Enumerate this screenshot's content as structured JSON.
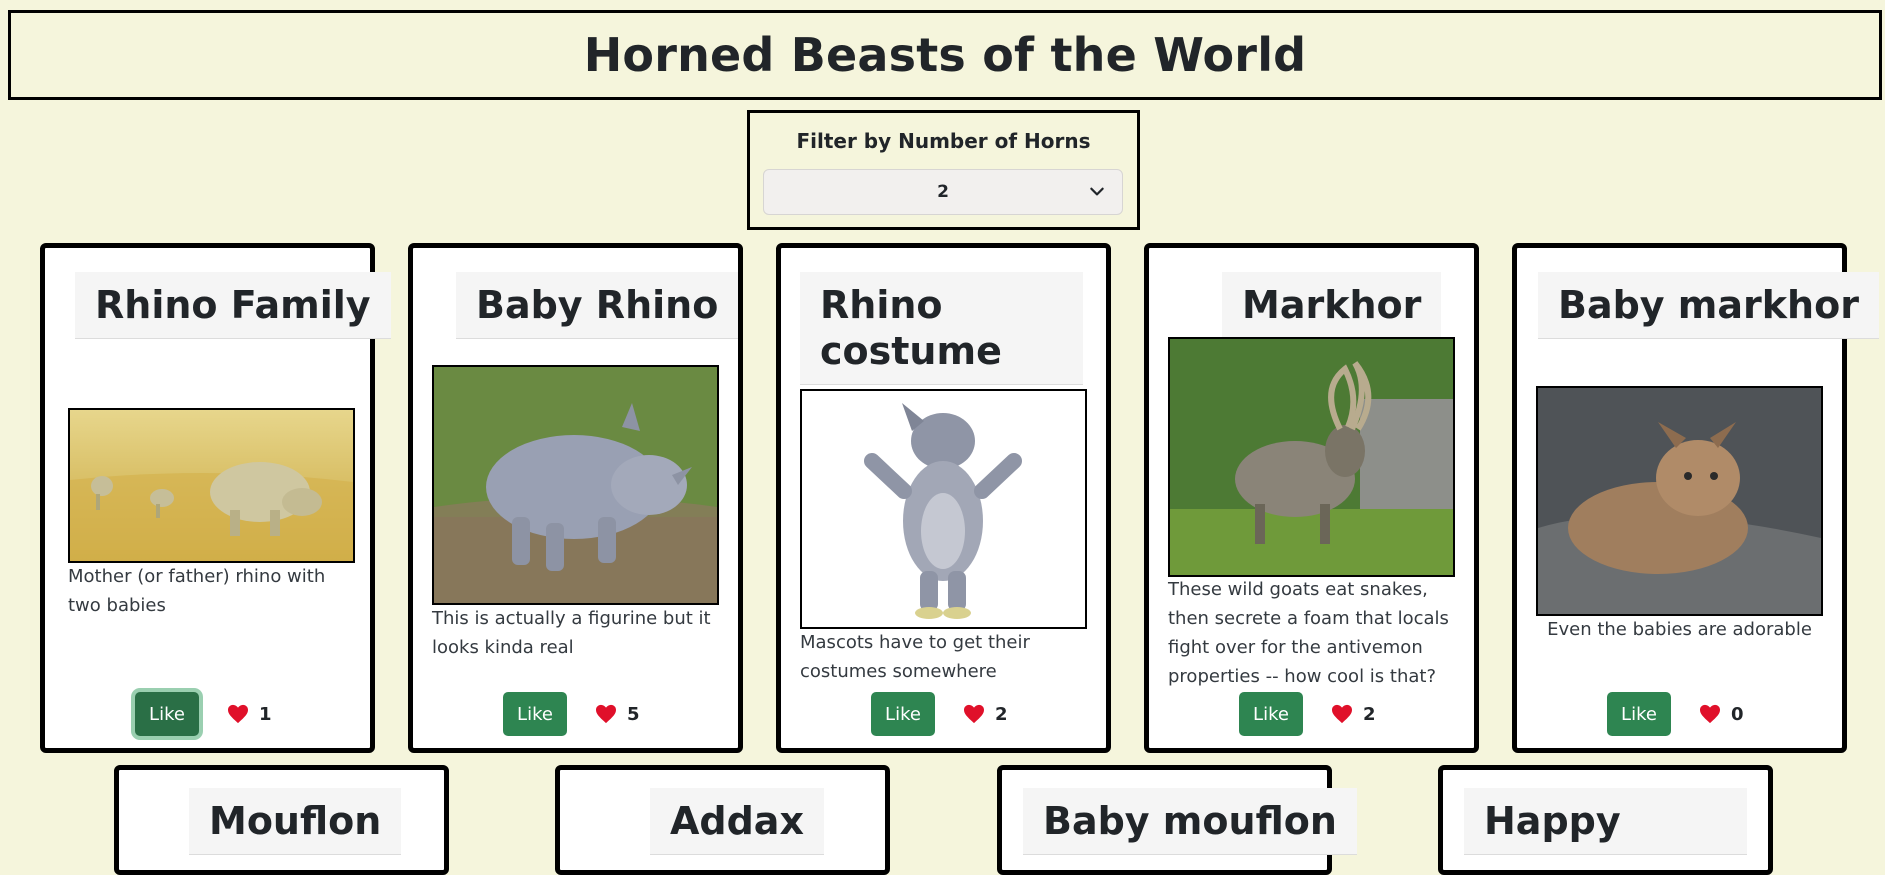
{
  "header": {
    "title": "Horned Beasts of the World"
  },
  "filter": {
    "label": "Filter by Number of Horns",
    "selected": "2"
  },
  "cards": [
    {
      "title": "Rhino Family",
      "description": "Mother (or father) rhino with two babies",
      "like_label": "Like",
      "likes": "1"
    },
    {
      "title": "Baby Rhino",
      "description": "This is actually a figurine but it looks kinda real",
      "like_label": "Like",
      "likes": "5"
    },
    {
      "title": "Rhino costume",
      "description": "Mascots have to get their costumes somewhere",
      "like_label": "Like",
      "likes": "2"
    },
    {
      "title": "Markhor",
      "description": "These wild goats eat snakes, then secrete a foam that locals fight over for the antivemon properties -- how cool is that?",
      "like_label": "Like",
      "likes": "2"
    },
    {
      "title": "Baby markhor",
      "description": "Even the babies are adorable",
      "like_label": "Like",
      "likes": "0"
    }
  ],
  "cards_row2": [
    {
      "title": "Mouflon"
    },
    {
      "title": "Addax"
    },
    {
      "title": "Baby mouflon"
    },
    {
      "title": "Happy"
    }
  ],
  "icons": {
    "like": "heart-icon",
    "dropdown": "chevron-down-icon"
  },
  "colors": {
    "background": "#f5f5dc",
    "like_button": "#2e8551",
    "heart": "#e0102a"
  }
}
